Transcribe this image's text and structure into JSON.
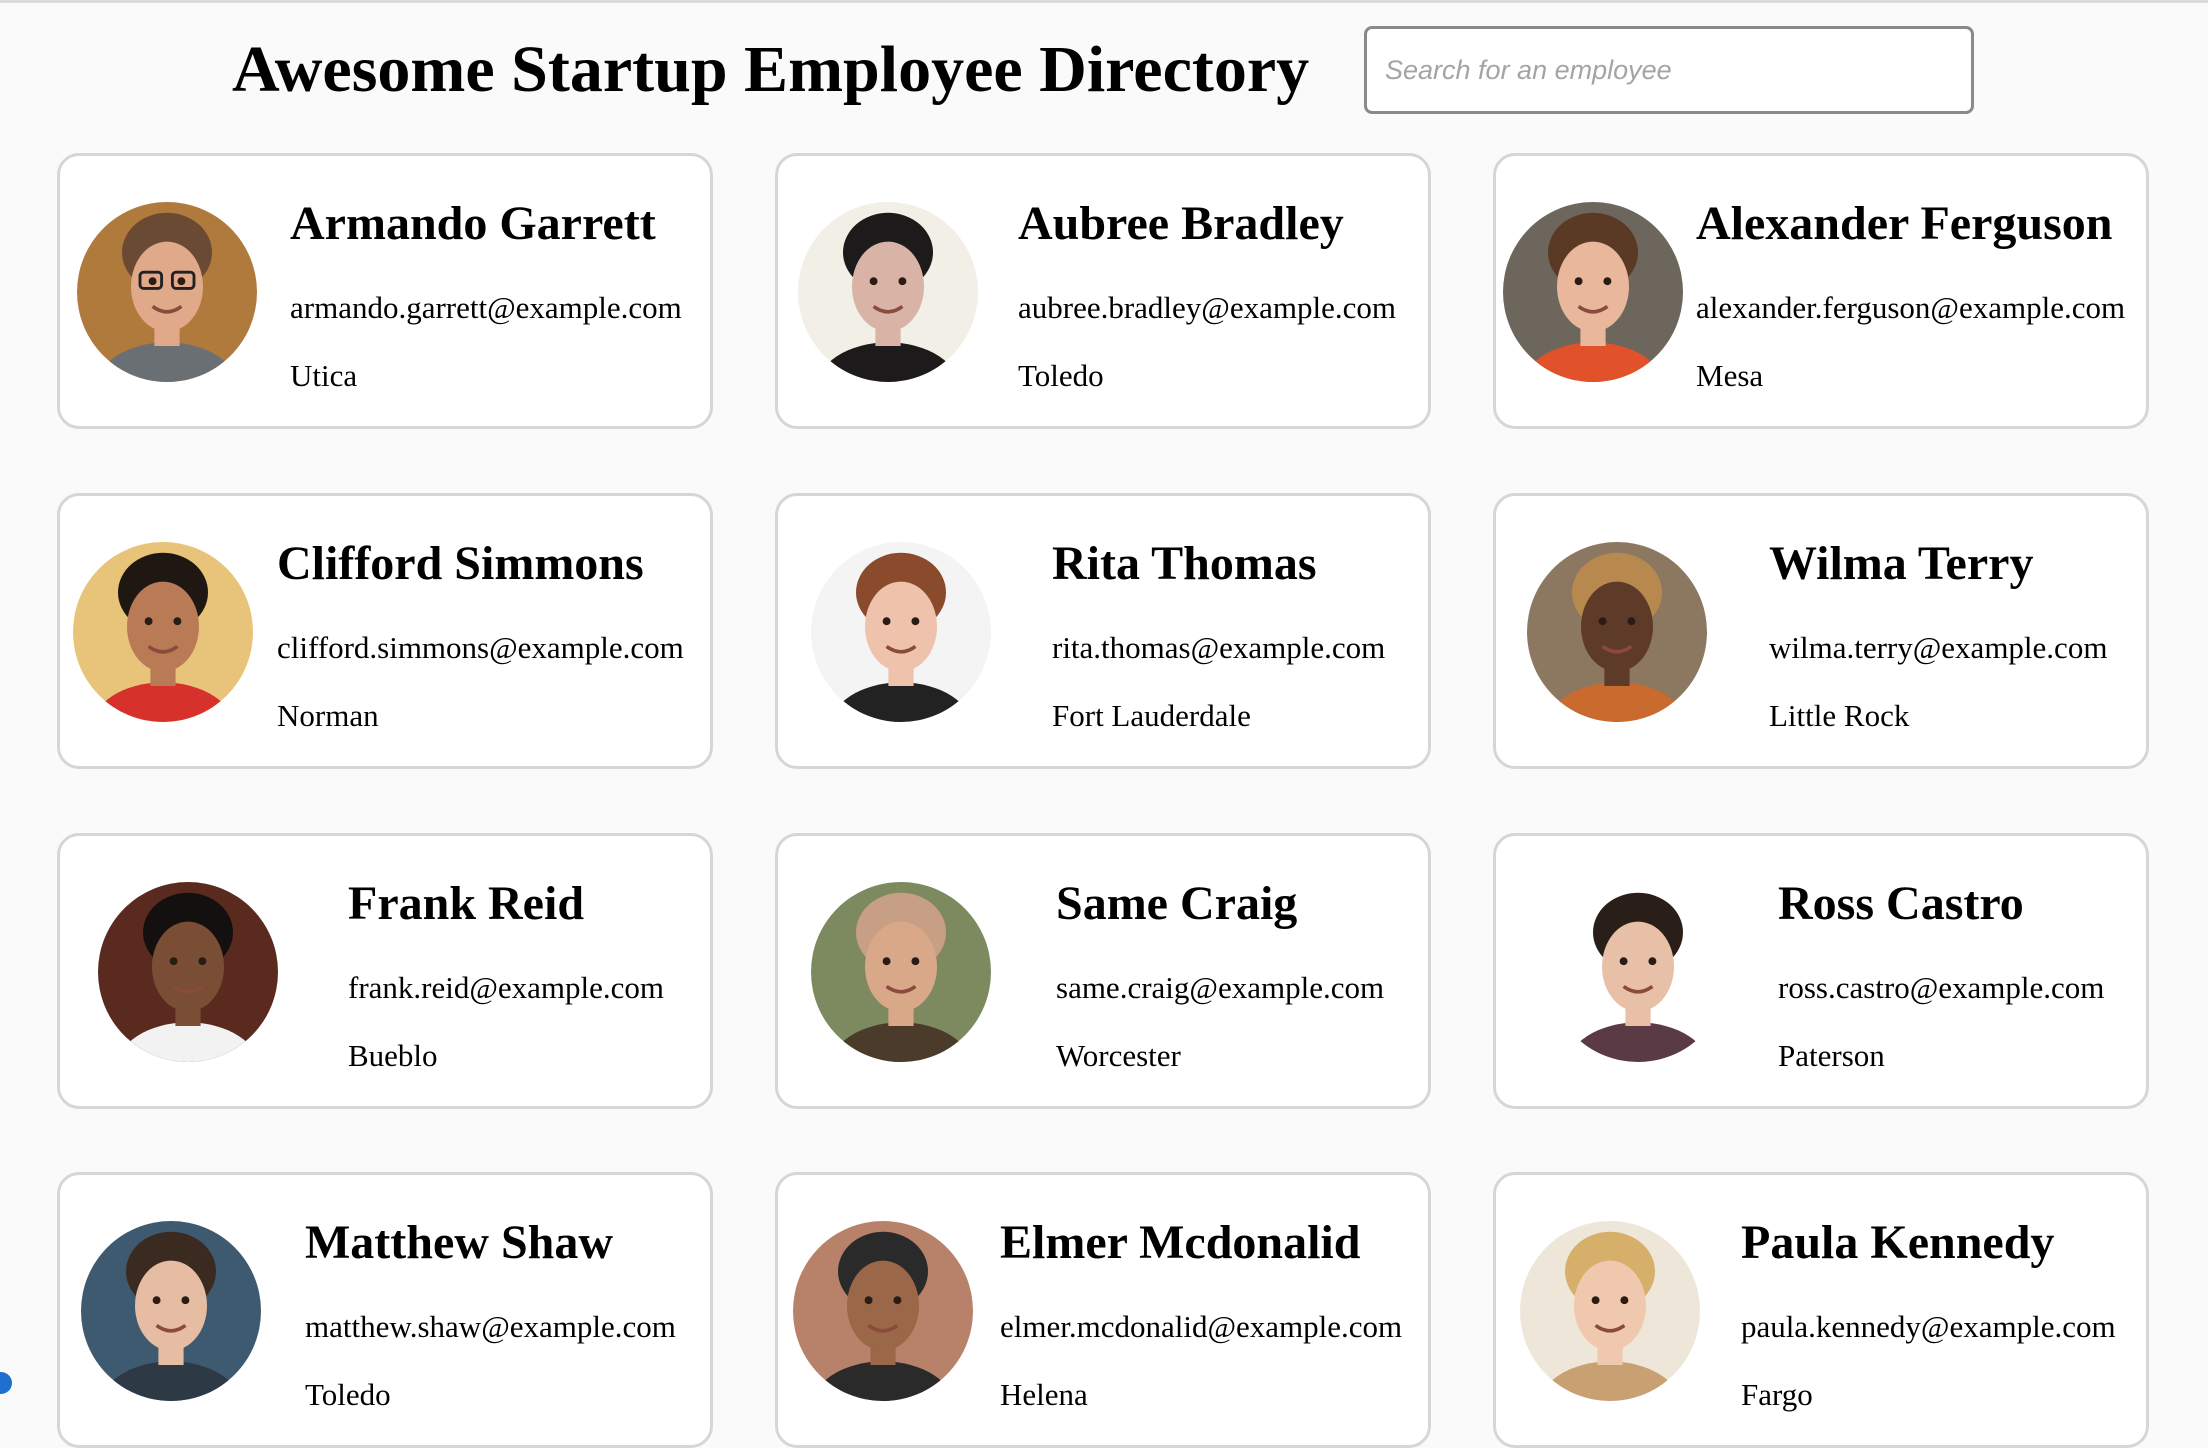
{
  "header": {
    "title": "Awesome Startup Employee Directory",
    "search_placeholder": "Search for an employee",
    "search_value": ""
  },
  "employees": [
    {
      "name": "Armando Garrett",
      "email": "armando.garrett@example.com",
      "city": "Utica",
      "photo": {
        "bg": "#b07a3c",
        "skin": "#e0a98a",
        "hair": "#6b4a33",
        "shirt": "#6a6f73",
        "glasses": true
      }
    },
    {
      "name": "Aubree Bradley",
      "email": "aubree.bradley@example.com",
      "city": "Toledo",
      "photo": {
        "bg": "#f2efe6",
        "skin": "#d9b4a6",
        "hair": "#1c1a1a",
        "shirt": "#1c1a1a",
        "glasses": false
      }
    },
    {
      "name": "Alexander Ferguson",
      "email": "alexander.ferguson@example.com",
      "city": "Mesa",
      "photo": {
        "bg": "#6c665d",
        "skin": "#e8b79c",
        "hair": "#5a3a25",
        "shirt": "#e2522a",
        "glasses": false
      }
    },
    {
      "name": "Clifford Simmons",
      "email": "clifford.simmons@example.com",
      "city": "Norman",
      "photo": {
        "bg": "#e8c47a",
        "skin": "#b97b55",
        "hair": "#1f1712",
        "shirt": "#d6312a",
        "glasses": false
      }
    },
    {
      "name": "Rita Thomas",
      "email": "rita.thomas@example.com",
      "city": "Fort Lauderdale",
      "photo": {
        "bg": "#f4f4f4",
        "skin": "#efc3ab",
        "hair": "#8a4a2c",
        "shirt": "#222222",
        "glasses": false
      }
    },
    {
      "name": "Wilma Terry",
      "email": "wilma.terry@example.com",
      "city": "Little Rock",
      "photo": {
        "bg": "#8c7860",
        "skin": "#5e3a28",
        "hair": "#b8894e",
        "shirt": "#c96a2e",
        "glasses": false
      }
    },
    {
      "name": "Frank Reid",
      "email": "frank.reid@example.com",
      "city": "Bueblo",
      "photo": {
        "bg": "#5a2a1e",
        "skin": "#7a4e35",
        "hair": "#141010",
        "shirt": "#f2f2f2",
        "glasses": false
      }
    },
    {
      "name": "Same Craig",
      "email": "same.craig@example.com",
      "city": "Worcester",
      "photo": {
        "bg": "#7d8a60",
        "skin": "#d8a888",
        "hair": "#c79f84",
        "shirt": "#4a3b2a",
        "glasses": false
      }
    },
    {
      "name": "Ross Castro",
      "email": "ross.castro@example.com",
      "city": "Paterson",
      "photo": {
        "bg": "#ffffff",
        "skin": "#e8c0a8",
        "hair": "#2a1e18",
        "shirt": "#5a3a44",
        "glasses": false
      }
    },
    {
      "name": "Matthew Shaw",
      "email": "matthew.shaw@example.com",
      "city": "Toledo",
      "photo": {
        "bg": "#3d5a70",
        "skin": "#e6bca2",
        "hair": "#3a2a20",
        "shirt": "#2d3a46",
        "glasses": false
      }
    },
    {
      "name": "Elmer Mcdonalid",
      "email": "elmer.mcdonalid@example.com",
      "city": "Helena",
      "photo": {
        "bg": "#b8826a",
        "skin": "#9a6748",
        "hair": "#2a2a2a",
        "shirt": "#2a2a2a",
        "glasses": false
      }
    },
    {
      "name": "Paula Kennedy",
      "email": "paula.kennedy@example.com",
      "city": "Fargo",
      "photo": {
        "bg": "#efe6da",
        "skin": "#f0c8ae",
        "hair": "#d6b06a",
        "shirt": "#c9a072",
        "glasses": false
      }
    }
  ]
}
